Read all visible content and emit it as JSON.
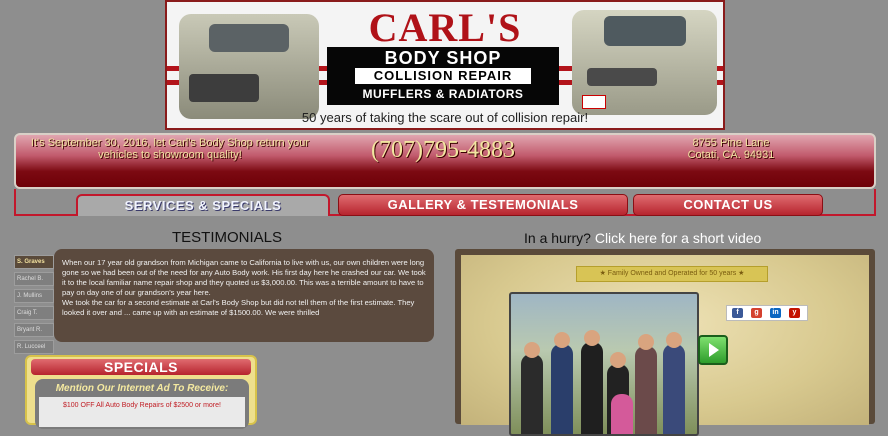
{
  "banner": {
    "brand": "CARL'S",
    "body_shop": "BODY SHOP",
    "collision": "COLLISION REPAIR",
    "mufflers": "MUFFLERS & RADIATORS",
    "tagline": "50 years of taking the scare out of collision repair!"
  },
  "infobar": {
    "left_text": "It's September 30, 2016, let Carl's Body Shop return your vehicles to showroom quality!",
    "phone": "(707)795-4883",
    "address_line1": "8755 Pine Lane",
    "address_line2": "Cotati, CA. 94931"
  },
  "nav": {
    "services": "SERVICES & SPECIALS",
    "gallery": "GALLERY & TESTEMONIALS",
    "contact": "CONTACT US"
  },
  "testimonials": {
    "heading": "TESTIMONIALS",
    "names": [
      "S. Graves",
      "Rachel B.",
      "J. Mullins",
      "Craig T.",
      "Bryant R.",
      "R. Lucceel"
    ],
    "paragraph1": "When our 17 year old grandson from Michigan came to California to live with us, our own children were long gone so we had been out of the need for any Auto Body work. His first day here he crashed our car. We took it to the local familiar name repair shop and they quoted us $3,000.00. This was a terrible amount to have to pay on day one of our grandson's year here.",
    "paragraph2": "We took the car for a second estimate at Carl's Body Shop but did not tell them of the first estimate. They looked it over and ... came up with an estimate of $1500.00. We were thrilled"
  },
  "specials": {
    "title": "SPECIALS",
    "ad": "Mention Our Internet Ad To Receive:",
    "offer": "$100 OFF All Auto Body Repairs of $2500 or more!"
  },
  "video": {
    "hurry_prefix": "In a hurry? ",
    "hurry_link": "Click here for a short video",
    "family_banner": "★ Family Owned and Operated for 50 years ★"
  },
  "colors": {
    "accent_red": "#b01218",
    "nav_red": "#c2182c",
    "panel_brown": "#5b4a3e"
  }
}
